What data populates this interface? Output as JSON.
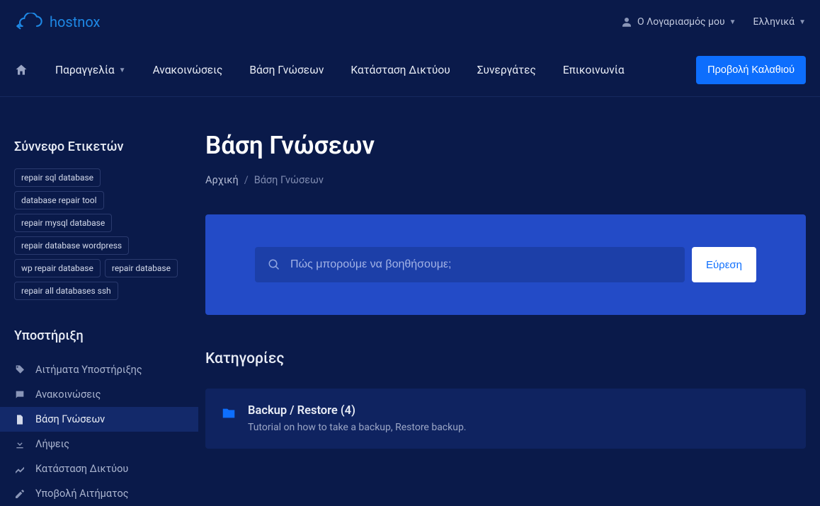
{
  "logo": {
    "text": "hostnox"
  },
  "topbar": {
    "account_label": "Ο Λογαριασμός μου",
    "language_label": "Ελληνικά"
  },
  "nav": {
    "order": "Παραγγελία",
    "announcements": "Ανακοινώσεις",
    "kb": "Βάση Γνώσεων",
    "network_status": "Κατάσταση Δικτύου",
    "partners": "Συνεργάτες",
    "contact": "Επικοινωνία",
    "cart": "Προβολή Καλαθιού"
  },
  "sidebar": {
    "tags_heading": "Σύννεφο Ετικετών",
    "tags": [
      "repair sql database",
      "database repair tool",
      "repair mysql database",
      "repair database wordpress",
      "wp repair database",
      "repair database",
      "repair all databases ssh"
    ],
    "support_heading": "Υποστήριξη",
    "support_items": [
      {
        "label": "Αιτήματα Υποστήριξης"
      },
      {
        "label": "Ανακοινώσεις"
      },
      {
        "label": "Βάση Γνώσεων"
      },
      {
        "label": "Λήψεις"
      },
      {
        "label": "Κατάσταση Δικτύου"
      },
      {
        "label": "Υποβολή Αιτήματος"
      }
    ]
  },
  "main": {
    "title": "Βάση Γνώσεων",
    "breadcrumb_home": "Αρχική",
    "breadcrumb_sep": "/",
    "breadcrumb_current": "Βάση Γνώσεων",
    "search_placeholder": "Πώς μπορούμε να βοηθήσουμε;",
    "search_button": "Εύρεση",
    "categories_heading": "Κατηγορίες",
    "category": {
      "title": "Backup / Restore (4)",
      "desc": "Tutorial on how to take a backup, Restore backup."
    }
  }
}
